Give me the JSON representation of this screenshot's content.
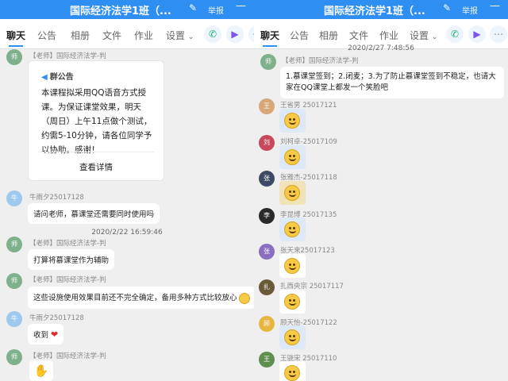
{
  "left": {
    "title": "国际经济法学1班（...",
    "report": "举报",
    "tabs": [
      "聊天",
      "公告",
      "相册",
      "文件",
      "作业",
      "设置"
    ],
    "messages": {
      "teacher_sender": "【老师】国际经济法学-判",
      "notice_head": "群公告",
      "notice_body": "本课程拟采用QQ语音方式授课。为保证课堂效果，明天（周日）上午11点做个测试，约需5-10分钟，请各位同学予以协助。感谢！",
      "notice_more": "查看详情",
      "student_sender": "牛雨夕25017128",
      "m1": "请问老师，慕课堂还需要同时使用吗",
      "ts1": "2020/2/22 16:59:46",
      "m2": "打算将慕课堂作为辅助",
      "m3": "这些设施使用效果目前还不完全确定，备用多种方式比较放心",
      "m4": "收到"
    }
  },
  "right": {
    "title": "国际经济法学1班（...",
    "report": "举报",
    "tabs": [
      "聊天",
      "公告",
      "相册",
      "文件",
      "作业",
      "设置"
    ],
    "timestamp": "2020/2/27 7:48:56",
    "teacher_sender": "【老师】国际经济法学-判",
    "teacher_message": "1.慕课堂签到；2.闭麦；3.为了防止慕课堂签到不稳定，也请大家在QQ课堂上都发一个笑脸吧",
    "students": [
      "王省男 25017121",
      "刘柯卓-25017109",
      "张雅杰-25017118",
      "李昆博 25017135",
      "张天来25017123",
      "扎西央宗 25017117",
      "顾天怡-25017122",
      "王骁宋 25017110"
    ]
  },
  "colors": {
    "accent": "#2f8ef2",
    "background": "#efefef"
  }
}
